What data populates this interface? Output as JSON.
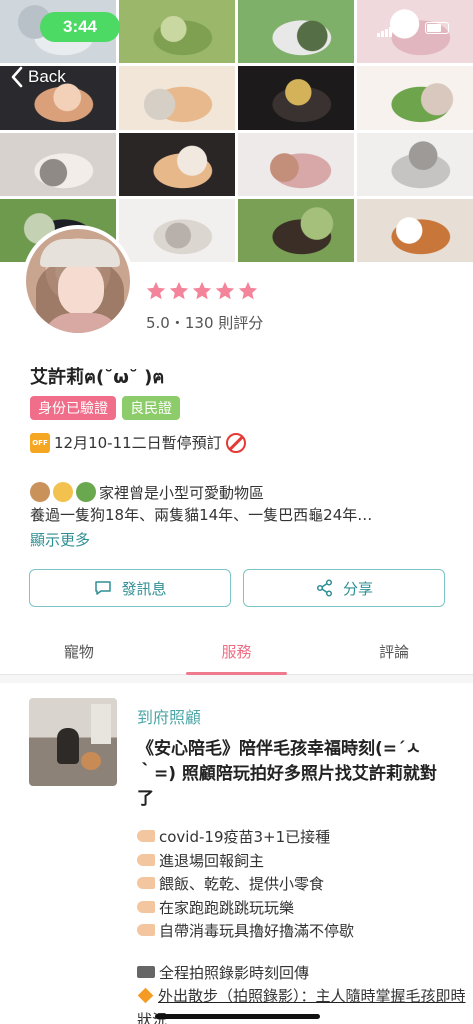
{
  "status_bar": {
    "time": "3:44"
  },
  "nav": {
    "back_label": "Back"
  },
  "photos": [
    {
      "name": "photo-dog-white-hand",
      "colors": [
        "#cfd6dc",
        "#e9ecef",
        "#b8c0c8"
      ]
    },
    {
      "name": "photo-dog-on-grass",
      "colors": [
        "#9bb86a",
        "#7ea050",
        "#c9d7a0"
      ]
    },
    {
      "name": "photo-dog-black-white",
      "colors": [
        "#7fb06a",
        "#e8e8e8",
        "#556e45"
      ]
    },
    {
      "name": "photo-dog-fluffy-pink",
      "colors": [
        "#f0d9dd",
        "#e2b6bf",
        "#ffffff"
      ]
    },
    {
      "name": "photo-dog-in-bed",
      "colors": [
        "#2a2a2e",
        "#d9a07a",
        "#f3d1b8"
      ]
    },
    {
      "name": "photo-cat-orange-white",
      "colors": [
        "#f2e6d8",
        "#e8b98c",
        "#d6cfc6"
      ]
    },
    {
      "name": "photo-cat-black",
      "colors": [
        "#1c1a1a",
        "#3a3230",
        "#d4b25a"
      ]
    },
    {
      "name": "photo-dog-poodle-grass",
      "colors": [
        "#f7f2ee",
        "#6ea44c",
        "#d9c8bd"
      ]
    },
    {
      "name": "photo-cat-fluffy-room",
      "colors": [
        "#d7d2cd",
        "#f2ede8",
        "#8f8a86"
      ]
    },
    {
      "name": "photo-cat-lying",
      "colors": [
        "#2a2626",
        "#e7b98a",
        "#f1e8df"
      ]
    },
    {
      "name": "photo-dog-treat-hand",
      "colors": [
        "#eeeaea",
        "#d8a8a8",
        "#c48f7a"
      ]
    },
    {
      "name": "photo-cat-grey-face",
      "colors": [
        "#f0efee",
        "#c6c4c2",
        "#9d9a98"
      ]
    },
    {
      "name": "photo-dog-in-park",
      "colors": [
        "#6e9a4e",
        "#1d1f26",
        "#c4d1b2"
      ]
    },
    {
      "name": "photo-dog-white-happy",
      "colors": [
        "#f2f0ee",
        "#dcd6d0",
        "#b8b0aa"
      ]
    },
    {
      "name": "photo-dog-shepherd-grass",
      "colors": [
        "#7aa055",
        "#3a2e26",
        "#a5c07a"
      ]
    },
    {
      "name": "photo-dog-corgi",
      "colors": [
        "#e7dfd6",
        "#c9763a",
        "#ffffff"
      ]
    }
  ],
  "profile": {
    "rating_stars": 5,
    "rating_text": "5.0・130 則評分",
    "name": "艾許莉ฅ(˘ω˘ )ฅ",
    "badges": {
      "verified": "身份已驗證",
      "citizen": "良民證"
    },
    "notice_icon_text": "OFF",
    "notice": "12月10-11二日暫停預訂",
    "bio_line1": "家裡曾是小型可愛動物區",
    "bio_line2": "養過一隻狗18年、兩隻貓14年、一隻巴西龜24年…",
    "show_more": "顯示更多"
  },
  "actions": {
    "message": "發訊息",
    "share": "分享"
  },
  "tabs": [
    {
      "label": "寵物",
      "active": false
    },
    {
      "label": "服務",
      "active": true
    },
    {
      "label": "評論",
      "active": false
    }
  ],
  "service": {
    "type": "到府照顧",
    "title": "《安心陪毛》陪伴毛孩幸福時刻(=´ㅅ｀=) 照顧陪玩拍好多照片找艾許莉就對了",
    "features": [
      {
        "icon": "point",
        "text": "covid-19疫苗3+1已接種"
      },
      {
        "icon": "point",
        "text": "進退場回報飼主"
      },
      {
        "icon": "point",
        "text": "餵飯、乾乾、提供小零食"
      },
      {
        "icon": "point",
        "text": "在家跑跑跳跳玩玩樂"
      },
      {
        "icon": "point",
        "text": "自帶消毒玩具擼好擼滿不停歇"
      },
      {
        "icon": "none",
        "text": ""
      },
      {
        "icon": "camera",
        "text": "全程拍照錄影時刻回傳"
      },
      {
        "icon": "diamond",
        "text": "外出散步（拍照錄影）：主人隨時掌握毛孩即時狀況"
      }
    ]
  },
  "colors": {
    "accent_pink": "#ef6d84",
    "accent_teal": "#2f8f93",
    "star_pink": "#f3849a",
    "badge_pink": "#f06e8a",
    "badge_green": "#8ccc6a",
    "status_green": "#4cd964"
  }
}
